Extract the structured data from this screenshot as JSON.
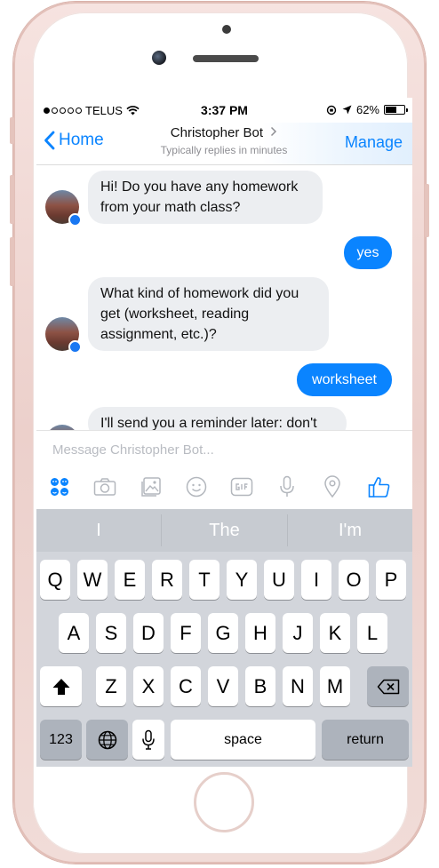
{
  "status_bar": {
    "carrier": "TELUS",
    "time": "3:37 PM",
    "battery": "62%",
    "battery_level": 0.62
  },
  "nav": {
    "back_label": "Home",
    "title": "Christopher Bot",
    "subtitle": "Typically replies in minutes",
    "manage_label": "Manage"
  },
  "messages": [
    {
      "from": "bot",
      "text": "Hi! Do you have any homework from your math class?"
    },
    {
      "from": "user",
      "text": "yes"
    },
    {
      "from": "bot",
      "text": "What kind of homework did you get (worksheet, reading assignment, etc.)?"
    },
    {
      "from": "user",
      "text": "worksheet"
    },
    {
      "from": "bot",
      "text": "I'll send you a reminder later: don't"
    }
  ],
  "composer": {
    "placeholder": "Message Christopher Bot...",
    "tools": [
      "apps-icon",
      "camera-icon",
      "gallery-icon",
      "emoji-icon",
      "gif-icon",
      "microphone-icon",
      "location-icon",
      "like-icon"
    ]
  },
  "colors": {
    "accent": "#0a84ff",
    "bubble_in": "#eceef1",
    "bubble_out": "#0a84ff",
    "keyboard_bg": "#d2d5db"
  },
  "keyboard": {
    "suggestions": [
      "I",
      "The",
      "I'm"
    ],
    "row1": [
      "Q",
      "W",
      "E",
      "R",
      "T",
      "Y",
      "U",
      "I",
      "O",
      "P"
    ],
    "row2": [
      "A",
      "S",
      "D",
      "F",
      "G",
      "H",
      "J",
      "K",
      "L"
    ],
    "row3": [
      "Z",
      "X",
      "C",
      "V",
      "B",
      "N",
      "M"
    ],
    "numbers_label": "123",
    "space_label": "space",
    "return_label": "return"
  }
}
